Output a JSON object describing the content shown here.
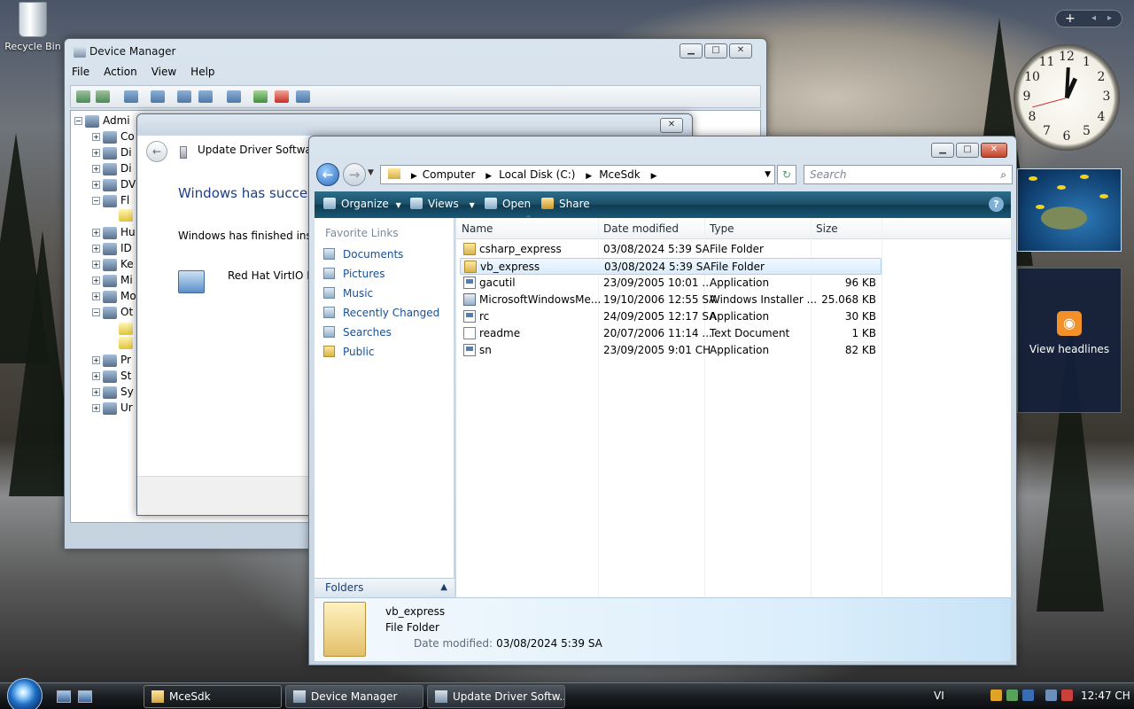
{
  "desktop": {
    "recycle_bin_label": "Recycle Bin"
  },
  "gadgets": {
    "bar_plus": "+",
    "bar_prev": "◂",
    "bar_next": "▸",
    "clock_numbers": [
      "12",
      "1",
      "2",
      "3",
      "4",
      "5",
      "6",
      "7",
      "8",
      "9",
      "10",
      "11"
    ],
    "clock_time": "12:47",
    "feed_label": "View headlines"
  },
  "device_manager": {
    "title": "Device Manager",
    "menu": [
      "File",
      "Action",
      "View",
      "Help"
    ],
    "tree": [
      "Admi",
      "Co",
      "Di",
      "Di",
      "DV",
      "Fl",
      "",
      "Hu",
      "ID",
      "Ke",
      "Mi",
      "Mo",
      "Ot",
      "",
      "",
      "Pr",
      "St",
      "Sy",
      "Ur"
    ]
  },
  "update_driver": {
    "title": "Update Driver Software -",
    "heading": "Windows has success",
    "message": "Windows has finished install",
    "device": "Red Hat VirtIO Eth"
  },
  "explorer": {
    "breadcrumb": [
      "Computer",
      "Local Disk (C:)",
      "McеSdk"
    ],
    "search_placeholder": "Search",
    "commands": [
      "Organize",
      "Views",
      "Open",
      "Share"
    ],
    "favorite_links_heading": "Favorite Links",
    "favorite_links": [
      "Documents",
      "Pictures",
      "Music",
      "Recently Changed",
      "Searches",
      "Public"
    ],
    "folders_label": "Folders",
    "columns": [
      "Name",
      "Date modified",
      "Type",
      "Size"
    ],
    "files": [
      {
        "name": "csharp_express",
        "date": "03/08/2024 5:39 SA",
        "type": "File Folder",
        "size": "",
        "icon": "folder"
      },
      {
        "name": "vb_express",
        "date": "03/08/2024 5:39 SA",
        "type": "File Folder",
        "size": "",
        "icon": "folder"
      },
      {
        "name": "gacutil",
        "date": "23/09/2005 10:01 ...",
        "type": "Application",
        "size": "96 KB",
        "icon": "app"
      },
      {
        "name": "MicrosoftWindowsMe...",
        "date": "19/10/2006 12:55 SA",
        "type": "Windows Installer ...",
        "size": "25.068 KB",
        "icon": "msi"
      },
      {
        "name": "rc",
        "date": "24/09/2005 12:17 SA",
        "type": "Application",
        "size": "30 KB",
        "icon": "app"
      },
      {
        "name": "readme",
        "date": "20/07/2006 11:14 ...",
        "type": "Text Document",
        "size": "1 KB",
        "icon": "txt"
      },
      {
        "name": "sn",
        "date": "23/09/2005 9:01 CH",
        "type": "Application",
        "size": "82 KB",
        "icon": "app"
      }
    ],
    "selected_index": 1,
    "details": {
      "name": "vb_express",
      "type": "File Folder",
      "date_label": "Date modified:",
      "date_value": "03/08/2024 5:39 SA"
    }
  },
  "taskbar": {
    "tasks": [
      "McеSdk",
      "Device Manager",
      "Update Driver Softw..."
    ],
    "language": "VI",
    "clock": "12:47 CH"
  }
}
